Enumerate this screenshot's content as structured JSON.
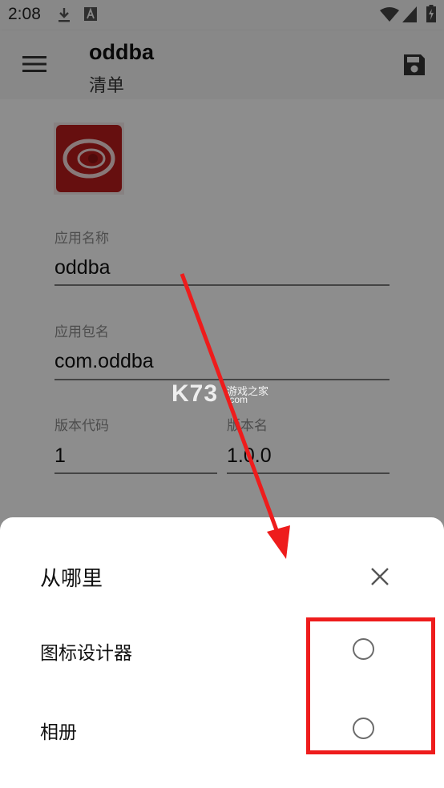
{
  "status_bar": {
    "time": "2:08"
  },
  "app_bar": {
    "title": "oddba",
    "subtitle": "清单"
  },
  "form": {
    "app_name_label": "应用名称",
    "app_name_value": "oddba",
    "package_label": "应用包名",
    "package_value": "com.oddba",
    "version_code_label": "版本代码",
    "version_code_value": "1",
    "version_name_label": "版本名",
    "version_name_value": "1.0.0"
  },
  "watermark": {
    "main": "K73",
    "sub_text": "游戏之家",
    "sub_domain": ".com"
  },
  "sheet": {
    "title": "从哪里",
    "options": [
      {
        "label": "图标设计器",
        "selected": false
      },
      {
        "label": "相册",
        "selected": false
      }
    ]
  },
  "colors": {
    "annotation": "#ee1c1c",
    "icon_red": "#b71c1c"
  }
}
